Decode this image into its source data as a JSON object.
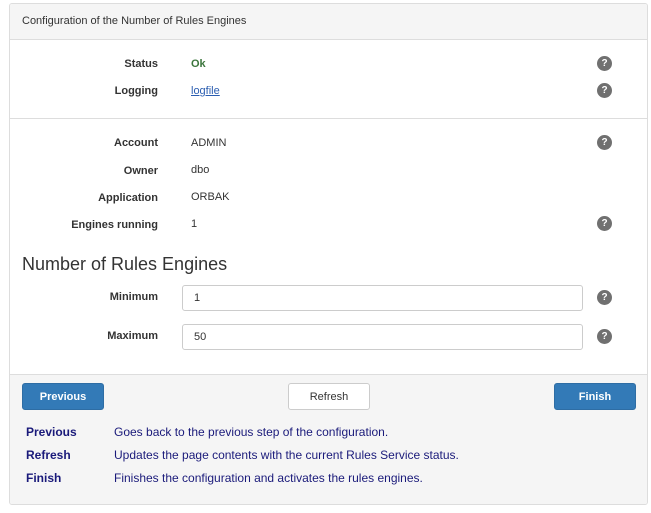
{
  "panel": {
    "title": "Configuration of the Number of Rules Engines"
  },
  "status": {
    "status_label": "Status",
    "status_value": "Ok",
    "logging_label": "Logging",
    "logging_value": "logfile"
  },
  "info": {
    "account_label": "Account",
    "account_value": "ADMIN",
    "owner_label": "Owner",
    "owner_value": "dbo",
    "application_label": "Application",
    "application_value": "ORBAK",
    "engines_label": "Engines running",
    "engines_value": "1"
  },
  "engines": {
    "title": "Number of Rules Engines",
    "minimum_label": "Minimum",
    "minimum_value": "1",
    "maximum_label": "Maximum",
    "maximum_value": "50"
  },
  "help_glyph": "?",
  "buttons": {
    "previous": "Previous",
    "refresh": "Refresh",
    "finish": "Finish"
  },
  "descriptions": [
    {
      "key": "Previous",
      "text": "Goes back to the previous step of the configuration."
    },
    {
      "key": "Refresh",
      "text": "Updates the page contents with the current Rules Service status."
    },
    {
      "key": "Finish",
      "text": "Finishes the configuration and activates the rules engines."
    }
  ],
  "colors": {
    "primary": "#337ab7",
    "ok": "#3c763d",
    "link": "#2a5db0",
    "description": "#1a1a7a",
    "help_icon": "#707070"
  },
  "icons": {
    "help": "question-circle-icon"
  }
}
